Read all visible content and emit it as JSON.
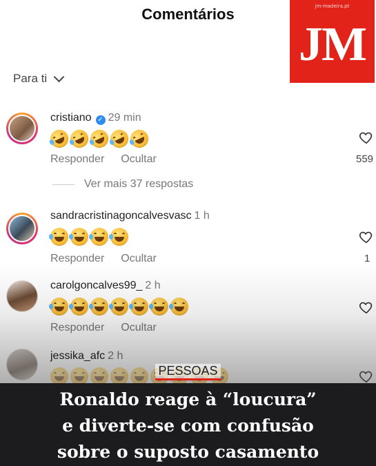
{
  "header": {
    "title": "Comentários"
  },
  "logo": {
    "url": "jm-madeira.pt",
    "text": "JM"
  },
  "sort": {
    "label": "Para ti"
  },
  "comments": [
    {
      "username": "cristiano",
      "verified": true,
      "time": "29 min",
      "emoji_count": 5,
      "reply": "Responder",
      "hide": "Ocultar",
      "likes": "559"
    },
    {
      "username": "sandracristinagoncalvesvasc",
      "verified": false,
      "time": "1 h",
      "emoji_count": 4,
      "reply": "Responder",
      "hide": "Ocultar",
      "likes": "1"
    },
    {
      "username": "carolgoncalves99_",
      "verified": false,
      "time": "2 h",
      "emoji_count": 7,
      "reply": "Responder",
      "hide": "Ocultar",
      "likes": ""
    },
    {
      "username": "jessika_afc",
      "verified": false,
      "time": "2 h",
      "emoji_count": 9,
      "reply": "",
      "hide": "",
      "likes": ""
    }
  ],
  "more_replies": "Ver mais 37 respostas",
  "section": "PESSOAS",
  "headline": {
    "line1": "Ronaldo reage à “loucura”",
    "line2": "e diverte-se com confusão",
    "line3": "sobre o suposto casamento"
  },
  "icons": [
    "verified-badge-icon",
    "heart-icon",
    "chevron-down-icon",
    "laughing-emoji-icon",
    "rofl-emoji-icon"
  ],
  "colors": {
    "brand_red": "#e2231a",
    "verified_blue": "#2d8cf0",
    "caption_bg": "#1c1c1e"
  }
}
